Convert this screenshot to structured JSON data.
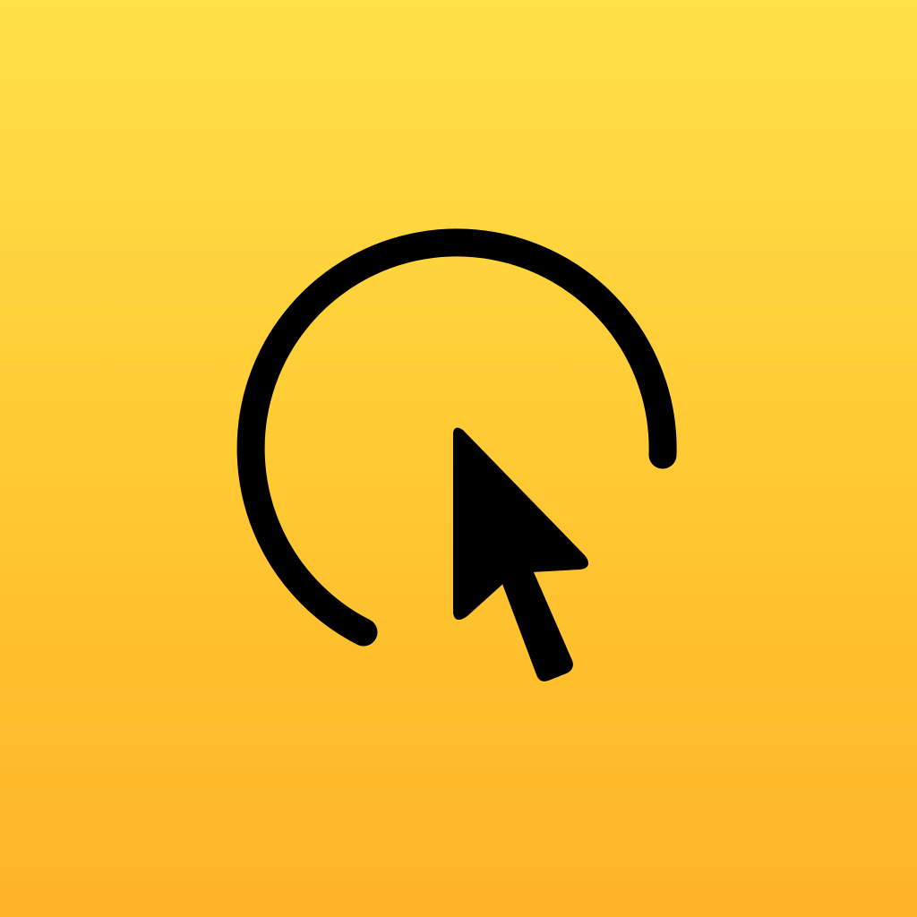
{
  "icon": {
    "name": "click-target-icon",
    "glyphs": [
      "arc-icon",
      "cursor-arrow-icon"
    ]
  },
  "colors": {
    "gradient_top": "#FFE14A",
    "gradient_middle": "#FFCA33",
    "gradient_bottom": "#FFB327",
    "glyph": "#000000"
  }
}
